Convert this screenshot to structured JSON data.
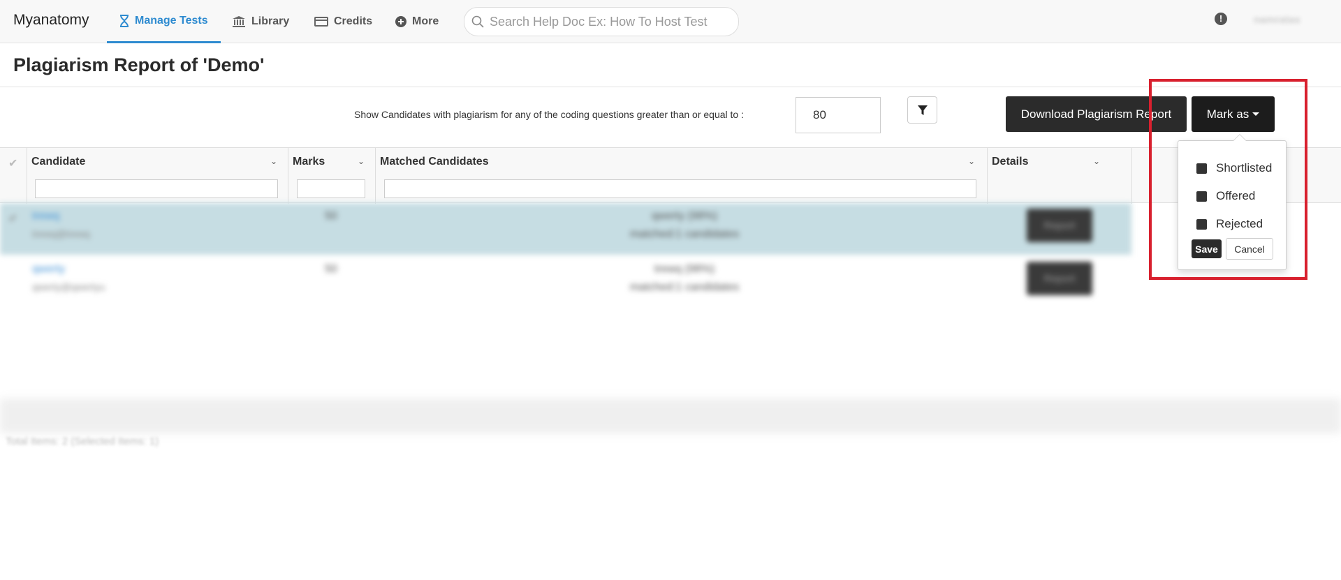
{
  "nav": {
    "brand": "Myanatomy",
    "items": [
      {
        "label": "Manage Tests",
        "icon": "hourglass-icon",
        "active": true
      },
      {
        "label": "Library",
        "icon": "bank-icon"
      },
      {
        "label": "Credits",
        "icon": "credit-card-icon"
      },
      {
        "label": "More",
        "icon": "plus-circle-icon"
      }
    ],
    "search_placeholder": "Search Help Doc Ex: How To Host Test",
    "user": "namratas",
    "accent_color": "#2e8bd0"
  },
  "page": {
    "title": "Plagiarism Report of 'Demo'"
  },
  "filter": {
    "label": "Show Candidates with plagiarism for any of the coding questions greater than or equal to :",
    "threshold": "80"
  },
  "actions": {
    "download": "Download Plagiarism Report",
    "mark_as": "Mark as"
  },
  "grid": {
    "columns": [
      "Candidate",
      "Marks",
      "Matched Candidates",
      "Details"
    ],
    "rows": [
      {
        "candidate": "trewq",
        "email": "trewq@trewq",
        "marks": "50",
        "matched": "qwerty (98%)",
        "matched_count": "matched:1 candidates",
        "details": "Report",
        "selected": true
      },
      {
        "candidate": "qwerty",
        "email": "qwerty@qwertyu",
        "marks": "50",
        "matched": "trewq (98%)",
        "matched_count": "matched:1 candidates",
        "details": "Report",
        "selected": false
      }
    ],
    "totals": "Total Items: 2 (Selected Items: 1)"
  },
  "dropdown": {
    "options": [
      "Shortlisted",
      "Offered",
      "Rejected"
    ],
    "save": "Save",
    "cancel": "Cancel"
  },
  "colors": {
    "highlight": "#d8202e",
    "selected_row": "#c6dde3",
    "dark_button": "#2b2b2b"
  }
}
